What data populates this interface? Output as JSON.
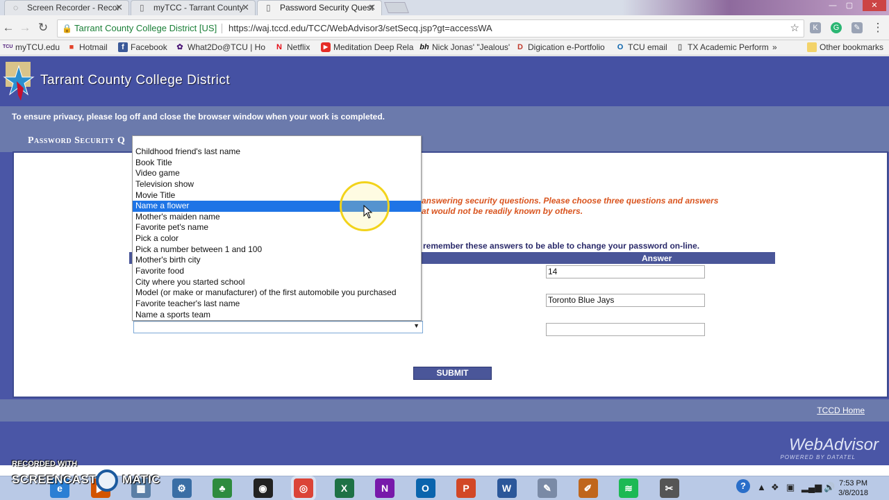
{
  "browser": {
    "tabs": [
      {
        "title": "Screen Recorder - Recor",
        "icon": "globe-icon"
      },
      {
        "title": "myTCC - Tarrant County",
        "icon": "page-icon"
      },
      {
        "title": "Password Security Quest",
        "icon": "page-icon"
      }
    ],
    "close_glyph": "✕",
    "address": {
      "secure_label": "Tarrant County College District [US]",
      "url": "https://waj.tccd.edu/TCC/WebAdvisor3/setSecq.jsp?gt=accessWA"
    },
    "bookmarks": [
      {
        "label": "myTCU.edu",
        "icon": "tcu-icon",
        "glyph": "TCU",
        "color": "#4d1979"
      },
      {
        "label": "Hotmail",
        "icon": "windows-icon",
        "glyph": "■",
        "color": "#e2432a"
      },
      {
        "label": "Facebook",
        "icon": "facebook-icon",
        "glyph": "f",
        "color": "#3b5998"
      },
      {
        "label": "What2Do@TCU | Ho",
        "icon": "tcu-frog-icon",
        "glyph": "✿",
        "color": "#4d1979"
      },
      {
        "label": "Netflix",
        "icon": "netflix-icon",
        "glyph": "N",
        "color": "#e50914"
      },
      {
        "label": "Meditation Deep Rela",
        "icon": "youtube-icon",
        "glyph": "▶",
        "color": "#e52d27"
      },
      {
        "label": "Nick Jonas' \"Jealous'",
        "icon": "bh-icon",
        "glyph": "bh",
        "color": "#111111"
      },
      {
        "label": "Digication e-Portfolio",
        "icon": "digication-icon",
        "glyph": "D",
        "color": "#c0392b"
      },
      {
        "label": "TCU email",
        "icon": "outlook-circle-icon",
        "glyph": "O",
        "color": "#0a64ad"
      },
      {
        "label": "TX Academic Perform",
        "icon": "page-icon",
        "glyph": "▯",
        "color": "#666666"
      }
    ],
    "more_bookmarks": "»",
    "other_bookmarks": "Other bookmarks"
  },
  "page": {
    "college_name": "Tarrant County College District",
    "privacy_notice": "To ensure privacy, please log off and close the browser window when your work is completed.",
    "section_title": "Password Security Q",
    "instructions_line1": "answering security questions.  Please choose three questions and answers",
    "instructions_line2": "at would not be readily known by others.",
    "remember_note": "remember these answers to be able to change your password on-line.",
    "answer_header": "Answer",
    "answers": [
      "14",
      "Toronto Blue Jays",
      ""
    ],
    "submit_label": "SUBMIT",
    "home_link": "TCCD Home",
    "brand": "WebAdvisor",
    "brand_sub": "POWERED BY DATATEL"
  },
  "dropdown": {
    "options": [
      "Childhood friend's last name",
      "Book Title",
      "Video game",
      "Television show",
      "Movie Title",
      "Name a flower",
      "Mother's maiden name",
      "Favorite pet's name",
      "Pick a color",
      "Pick a number between 1 and 100",
      "Mother's birth city",
      "Favorite food",
      "City where you started school",
      "Model (or make or manufacturer) of the first automobile you purchased",
      "Favorite teacher's last name",
      "Name a sports team"
    ],
    "highlighted": "Name a flower",
    "selected_value": ""
  },
  "watermark": {
    "line1": "RECORDED WITH",
    "line2a": "SCREENCAST",
    "line2b": "MATIC"
  },
  "taskbar": {
    "apps": [
      {
        "name": "ie-icon",
        "glyph": "e",
        "color": "#2a7fd4"
      },
      {
        "name": "media-icon",
        "glyph": "▶",
        "color": "#d35400"
      },
      {
        "name": "calculator-icon",
        "glyph": "▦",
        "color": "#5b7fa6"
      },
      {
        "name": "settings-icon",
        "glyph": "⚙",
        "color": "#3a6ea5"
      },
      {
        "name": "evernote-icon",
        "glyph": "♣",
        "color": "#2e8b3e"
      },
      {
        "name": "media-player-icon",
        "glyph": "◉",
        "color": "#222222"
      },
      {
        "name": "chrome-icon",
        "glyph": "◎",
        "color": "#db4437",
        "active": true
      },
      {
        "name": "excel-icon",
        "glyph": "X",
        "color": "#1e7145"
      },
      {
        "name": "onenote-icon",
        "glyph": "N",
        "color": "#7719aa"
      },
      {
        "name": "outlook-icon",
        "glyph": "O",
        "color": "#0a64ad"
      },
      {
        "name": "powerpoint-icon",
        "glyph": "P",
        "color": "#d24726"
      },
      {
        "name": "word-icon",
        "glyph": "W",
        "color": "#2b579a"
      },
      {
        "name": "paint-icon",
        "glyph": "✎",
        "color": "#7a8aa6"
      },
      {
        "name": "sketch-icon",
        "glyph": "✐",
        "color": "#c0661c"
      },
      {
        "name": "spotify-icon",
        "glyph": "≋",
        "color": "#1db954"
      },
      {
        "name": "snipping-icon",
        "glyph": "✂",
        "color": "#555555"
      }
    ],
    "time": "7:53 PM",
    "date": "3/8/2018"
  }
}
